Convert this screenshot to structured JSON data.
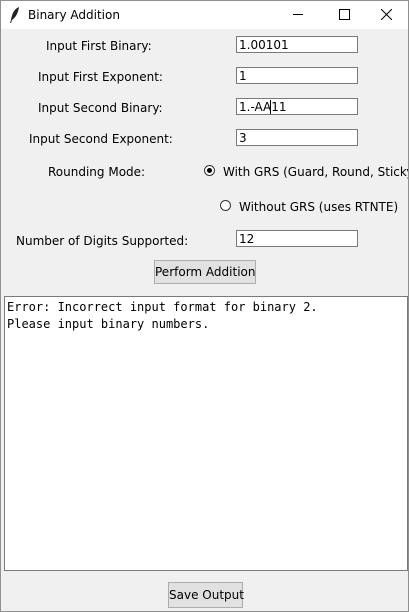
{
  "window": {
    "title": "Binary Addition"
  },
  "form": {
    "first_binary_label": "Input First Binary:",
    "first_binary_value": "1.00101",
    "first_exponent_label": "Input First Exponent:",
    "first_exponent_value": "1",
    "second_binary_label": "Input Second Binary:",
    "second_binary_value": "1.-AA11",
    "second_exponent_label": "Input Second Exponent:",
    "second_exponent_value": "3",
    "rounding_mode_label": "Rounding Mode:",
    "rounding_options": [
      {
        "label": "With GRS (Guard, Round, Sticky)",
        "selected": true
      },
      {
        "label": "Without GRS (uses RTNTE)",
        "selected": false
      }
    ],
    "digits_label": "Number of Digits Supported:",
    "digits_value": "12"
  },
  "actions": {
    "perform_label": "Perform Addition",
    "save_label": "Save Output"
  },
  "output": {
    "lines": [
      "Error: Incorrect input format for binary 2.",
      "Please input binary numbers."
    ]
  },
  "icons": {
    "app": "feather-icon",
    "minimize": "minimize-icon",
    "maximize": "maximize-icon",
    "close": "close-icon"
  }
}
